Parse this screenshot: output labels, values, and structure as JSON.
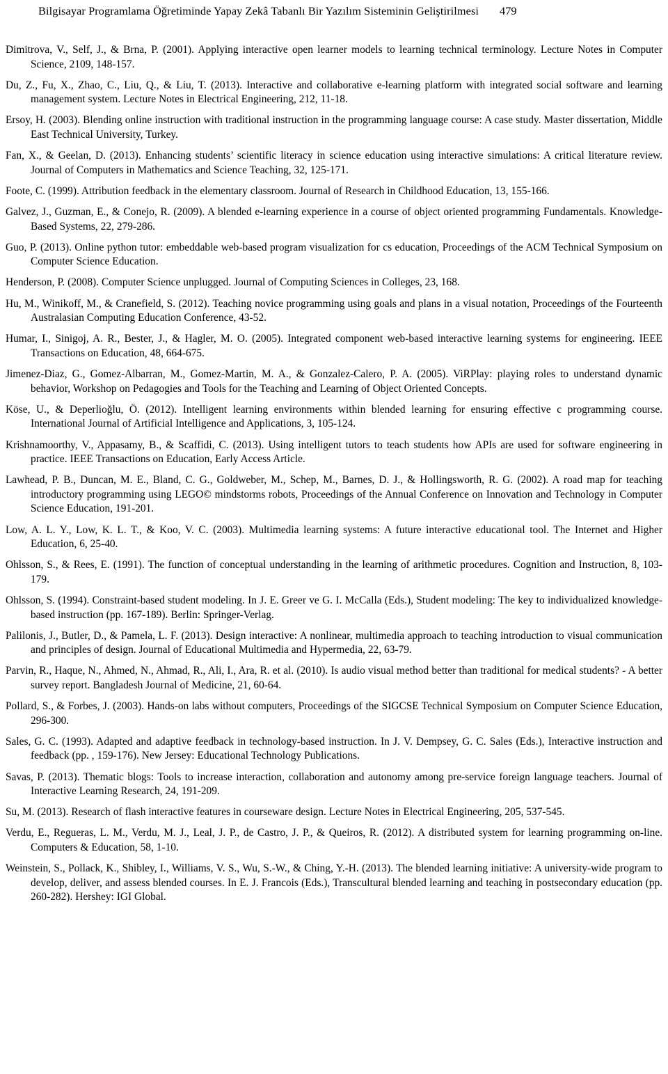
{
  "header": {
    "running_title": "Bilgisayar Programlama Öğretiminde Yapay Zekâ Tabanlı Bir Yazılım Sisteminin Geliştirilmesi",
    "page_number": "479"
  },
  "references": [
    {
      "id": "dimitrova-2001",
      "text": "Dimitrova, V., Self, J., & Brna, P. (2001). Applying interactive open learner models to learning technical terminology. Lecture Notes in Computer Science, 2109, 148-157."
    },
    {
      "id": "du-2013",
      "text": "Du, Z., Fu, X., Zhao, C., Liu, Q., & Liu, T. (2013). Interactive and collaborative e-learning platform with integrated social software and learning management system. Lecture Notes in Electrical Engineering, 212, 11-18."
    },
    {
      "id": "ersoy-2003",
      "text": "Ersoy, H. (2003). Blending online instruction with traditional instruction in the programming language course: A case study. Master dissertation, Middle East Technical University, Turkey."
    },
    {
      "id": "fan-geelan-2013",
      "text": "Fan, X., & Geelan, D. (2013). Enhancing students’ scientific literacy in science education using interactive simulations: A critical literature review. Journal of Computers in Mathematics and Science Teaching, 32, 125-171."
    },
    {
      "id": "foote-1999",
      "text": "Foote, C. (1999). Attribution feedback in the elementary classroom. Journal of Research in Childhood Education, 13, 155-166."
    },
    {
      "id": "galvez-2009",
      "text": "Galvez, J., Guzman, E., & Conejo, R. (2009). A blended e-learning experience in a course of object oriented programming Fundamentals. Knowledge-Based Systems, 22, 279-286."
    },
    {
      "id": "guo-2013",
      "text": "Guo, P. (2013). Online python tutor: embeddable web-based program visualization for cs education, Proceedings of the ACM Technical Symposium on Computer Science Education."
    },
    {
      "id": "henderson-2008",
      "text": "Henderson, P. (2008). Computer Science unplugged. Journal of Computing Sciences in Colleges, 23, 168."
    },
    {
      "id": "hu-2012",
      "text": "Hu, M., Winikoff, M., & Cranefield, S. (2012). Teaching novice programming using goals and plans in a visual notation, Proceedings of the Fourteenth Australasian Computing Education Conference, 43-52."
    },
    {
      "id": "humar-2005",
      "text": "Humar, I., Sinigoj, A. R., Bester, J., & Hagler, M. O. (2005). Integrated component web-based interactive learning systems for engineering. IEEE Transactions on Education, 48, 664-675."
    },
    {
      "id": "jimenez-diaz-2005",
      "text": "Jimenez-Diaz, G., Gomez-Albarran, M., Gomez-Martin, M. A., & Gonzalez-Calero, P. A. (2005). ViRPlay: playing roles to understand dynamic behavior, Workshop on Pedagogies and Tools for the Teaching and Learning of Object Oriented Concepts."
    },
    {
      "id": "kose-2012",
      "text": "Köse, U., & Deperlioğlu, Ö. (2012). Intelligent learning environments within blended learning for ensuring effective c programming course. International Journal of Artificial Intelligence and Applications, 3, 105-124."
    },
    {
      "id": "krishnamoorthy-2013",
      "text": "Krishnamoorthy, V., Appasamy, B., & Scaffidi, C. (2013). Using intelligent tutors to teach students how APIs are used for software engineering in practice. IEEE Transactions on Education, Early Access Article."
    },
    {
      "id": "lawhead-2002",
      "text": "Lawhead, P. B., Duncan, M. E., Bland, C. G., Goldweber, M., Schep, M., Barnes, D. J., & Hollingsworth, R. G. (2002). A road map for teaching introductory programming using LEGO© mindstorms robots, Proceedings of the Annual Conference on Innovation and Technology in Computer Science Education, 191-201."
    },
    {
      "id": "low-2003",
      "text": "Low, A. L. Y., Low, K. L. T., & Koo, V. C. (2003). Multimedia learning systems: A future interactive educational tool. The Internet and Higher Education, 6, 25-40."
    },
    {
      "id": "ohlsson-rees-1991",
      "text": "Ohlsson, S., & Rees, E. (1991). The function of conceptual understanding in the learning of arithmetic procedures. Cognition and Instruction, 8, 103-179."
    },
    {
      "id": "ohlsson-1994",
      "text": "Ohlsson, S. (1994). Constraint-based student modeling. In J. E. Greer ve G. I. McCalla (Eds.), Student modeling: The key to individualized knowledge-based instruction (pp. 167-189). Berlin: Springer-Verlag."
    },
    {
      "id": "palilonis-2013",
      "text": "Palilonis, J., Butler, D., & Pamela, L. F. (2013). Design interactive: A nonlinear, multimedia approach to teaching introduction to visual communication and principles of design. Journal of Educational Multimedia and Hypermedia, 22, 63-79."
    },
    {
      "id": "parvin-2010",
      "text": "Parvin, R., Haque, N., Ahmed, N., Ahmad, R., Ali, I., Ara, R. et al. (2010). Is audio visual method better than traditional for medical students? - A better survey report. Bangladesh Journal of Medicine, 21, 60-64."
    },
    {
      "id": "pollard-forbes-2003",
      "text": "Pollard, S., & Forbes, J. (2003). Hands-on labs without computers, Proceedings of the SIGCSE Technical Symposium on Computer Science Education, 296-300."
    },
    {
      "id": "sales-1993",
      "text": "Sales, G. C. (1993). Adapted and adaptive feedback in technology-based instruction. In J. V. Dempsey, G. C. Sales (Eds.), Interactive instruction and feedback (pp. , 159-176). New Jersey: Educational Technology Publications."
    },
    {
      "id": "savas-2013",
      "text": "Savas, P. (2013). Thematic blogs: Tools to increase interaction, collaboration and autonomy among pre-service foreign language teachers. Journal of Interactive Learning Research, 24, 191-209."
    },
    {
      "id": "su-2013",
      "text": "Su, M. (2013). Research of flash interactive features in courseware design. Lecture Notes in Electrical Engineering, 205, 537-545."
    },
    {
      "id": "verdu-2012",
      "text": "Verdu, E., Regueras, L. M., Verdu, M. J., Leal, J. P., de Castro, J. P., & Queiros, R. (2012). A distributed system for learning programming on-line. Computers & Education, 58, 1-10."
    },
    {
      "id": "weinstein-2013",
      "text": "Weinstein, S., Pollack, K., Shibley, I., Williams, V. S., Wu, S.-W., & Ching, Y.-H. (2013). The blended learning initiative: A university-wide program to develop, deliver, and assess blended courses. In E. J. Francois (Eds.), Transcultural blended learning and teaching in postsecondary education (pp. 260-282). Hershey: IGI Global."
    }
  ]
}
